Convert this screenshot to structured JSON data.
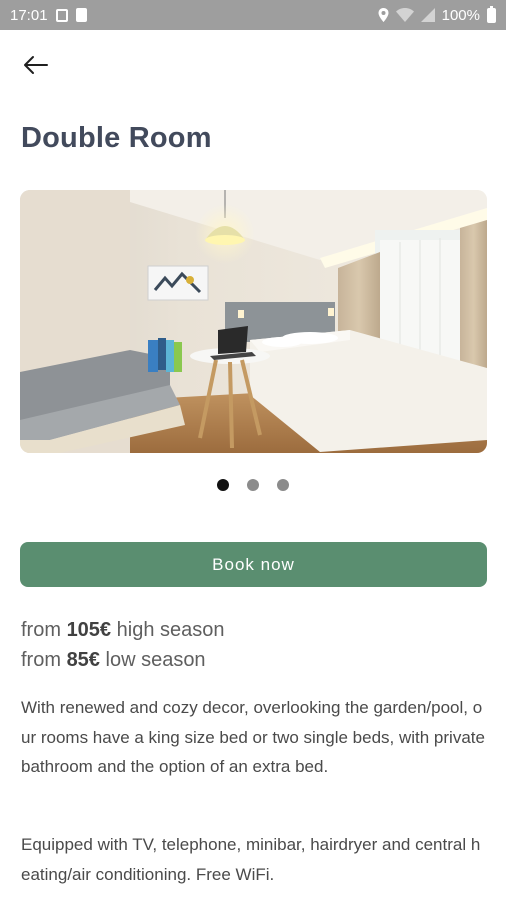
{
  "status_bar": {
    "time": "17:01",
    "battery": "100%",
    "icons": [
      "screenshot-icon",
      "storage-icon",
      "location-icon",
      "wifi-icon",
      "signal-icon",
      "battery-icon"
    ]
  },
  "header": {
    "back_icon": "arrow-left-icon",
    "title": "Double Room"
  },
  "gallery": {
    "image_subject": "hotel-room-photo",
    "active_index": 0,
    "dot_count": 3
  },
  "book_button": {
    "label": "Book now",
    "color": "#5a8e70"
  },
  "prices": [
    {
      "prefix": "from",
      "amount": "105€",
      "suffix": "high season"
    },
    {
      "prefix": "from",
      "amount": "85€",
      "suffix": "low season"
    }
  ],
  "description": [
    "With renewed and cozy decor, overlooking the garden/pool, our rooms have a king size bed or two single beds, with private bathroom and the option of an extra bed.",
    "Equipped with TV, telephone, minibar, hairdryer and central heating/air conditioning. Free WiFi."
  ]
}
